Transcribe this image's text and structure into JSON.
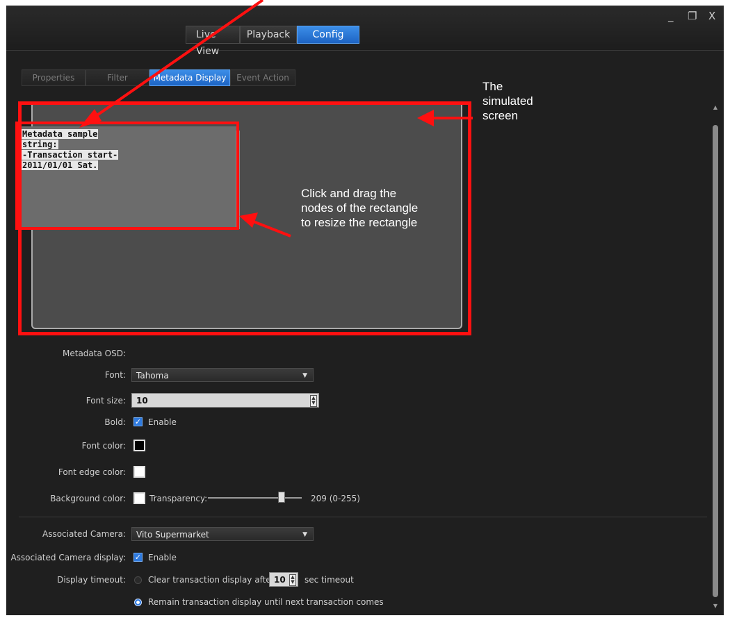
{
  "window": {
    "minimize_glyph": "_",
    "restore_glyph": "❐",
    "close_glyph": "X"
  },
  "main_tabs": [
    "Live View",
    "Playback",
    "Config"
  ],
  "sub_tabs": [
    "Properties",
    "Filter",
    "Metadata Display",
    "Event Action"
  ],
  "preview": {
    "metadata_text": [
      "Metadata sample",
      "string:",
      "-Transaction start-",
      "2011/01/01 Sat."
    ]
  },
  "annotations": {
    "simulated_screen": [
      "The",
      "simulated",
      "screen"
    ],
    "drag_hint": [
      "Click and drag the",
      "nodes of the rectangle",
      "to resize the rectangle"
    ]
  },
  "form": {
    "metadata_osd_label": "Metadata OSD:",
    "font_label": "Font:",
    "font_value": "Tahoma",
    "font_size_label": "Font size:",
    "font_size_value": "10",
    "bold_label": "Bold:",
    "bold_enable": "Enable",
    "font_color_label": "Font color:",
    "font_edge_color_label": "Font edge color:",
    "background_color_label": "Background color:",
    "transparency_label": "Transparency:",
    "transparency_value": "209 (0-255)",
    "transparency_level": 209,
    "associated_camera_label": "Associated Camera:",
    "associated_camera_value": "Vito Supermarket",
    "associated_camera_display_label": "Associated Camera display:",
    "associated_camera_display_enable": "Enable",
    "display_timeout_label": "Display timeout:",
    "clear_option": "Clear transaction display after",
    "timeout_value": "10",
    "sec_timeout": "sec timeout",
    "remain_option": "Remain transaction display until next transaction comes"
  },
  "colors": {
    "accent": "#2f7be0",
    "annotation_red": "#ff1010",
    "font_color": "#000000",
    "font_edge_color": "#ffffff",
    "background_color": "#ffffff"
  }
}
